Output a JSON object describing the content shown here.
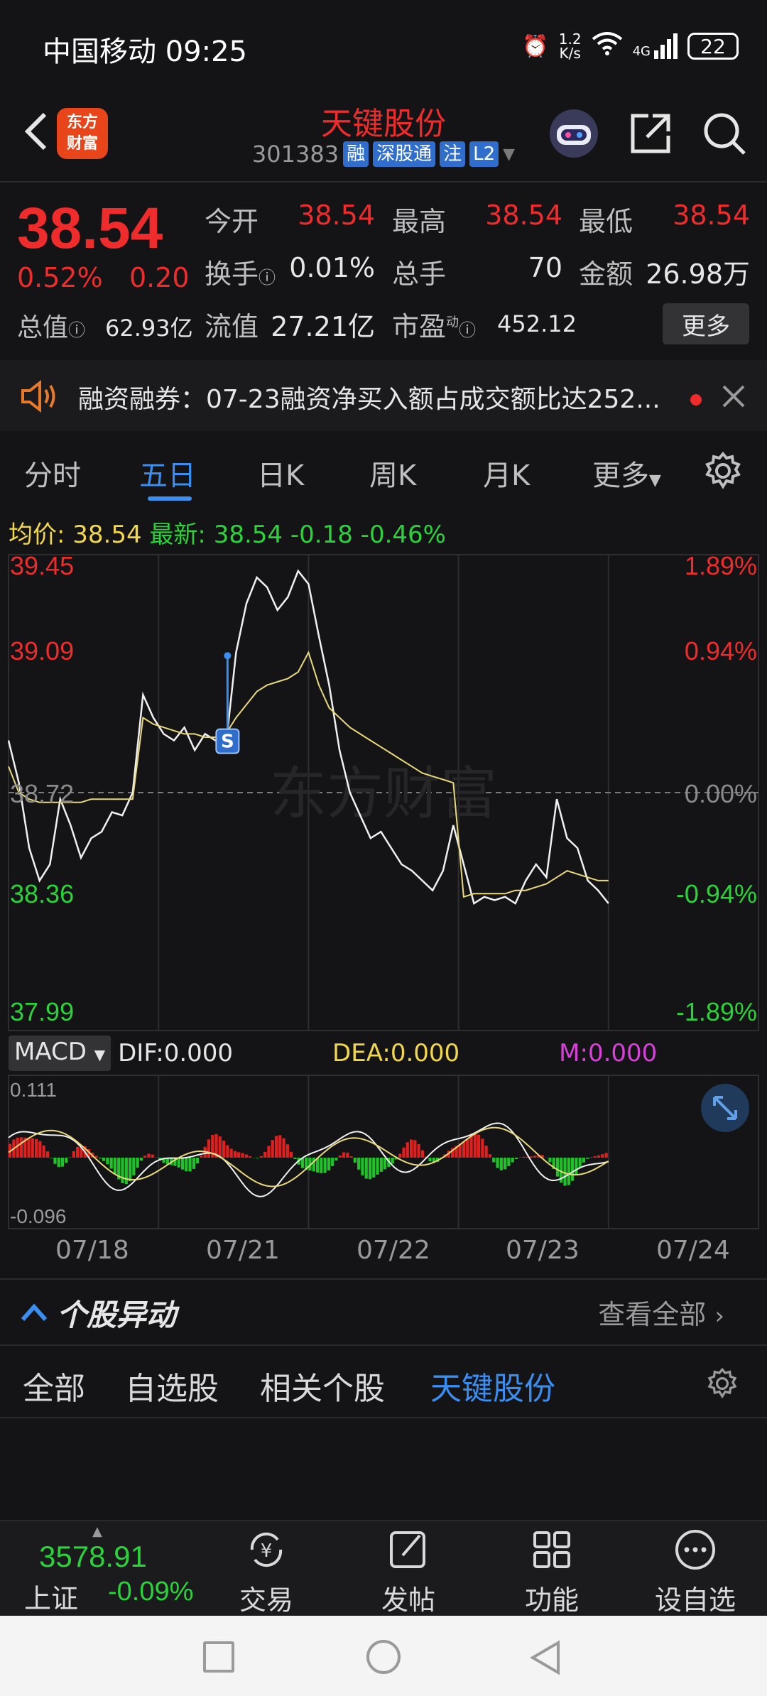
{
  "status_bar": {
    "carrier": "中国移动",
    "time": "09:25",
    "net_speed_top": "1.2",
    "net_speed_bottom": "K/s",
    "signal": "4G",
    "battery": "22"
  },
  "header": {
    "logo_line1": "东方",
    "logo_line2": "财富",
    "stock_name": "天键股份",
    "stock_code": "301383",
    "tags": [
      "融",
      "深股通",
      "注",
      "L2"
    ]
  },
  "quote": {
    "price": "38.54",
    "change_pct": "0.52%",
    "change_amt": "0.20",
    "open_label": "今开",
    "open": "38.54",
    "high_label": "最高",
    "high": "38.54",
    "low_label": "最低",
    "low": "38.54",
    "turnover_label": "换手",
    "turnover": "0.01%",
    "volume_label": "总手",
    "volume": "70",
    "amount_label": "金额",
    "amount": "26.98万",
    "mktcap_label": "总值",
    "mktcap": "62.93亿",
    "float_label": "流值",
    "float_cap": "27.21亿",
    "pe_label": "市盈",
    "pe_sup": "动",
    "pe": "452.12",
    "more_label": "更多"
  },
  "news": {
    "text": "融资融券：07-23融资净买入额占成交额比达252..."
  },
  "tabs": [
    "分时",
    "五日",
    "日K",
    "周K",
    "月K",
    "更多"
  ],
  "chart_info": {
    "avg_label": "均价:",
    "avg": "38.54",
    "latest_label": "最新:",
    "latest": "38.54",
    "chg": "-0.18",
    "chg_pct": "-0.46%"
  },
  "watermark": "东方财富",
  "marker": "S",
  "macd": {
    "selector": "MACD",
    "dif": "DIF:0.000",
    "dea": "DEA:0.000",
    "m": "M:0.000",
    "top": "0.111",
    "bottom": "-0.096"
  },
  "chart_data": {
    "type": "line",
    "x": [
      "07/18",
      "07/21",
      "07/22",
      "07/23",
      "07/24"
    ],
    "y_ticks_left": [
      "39.45",
      "39.09",
      "38.72",
      "38.36",
      "37.99"
    ],
    "y_ticks_right": [
      "1.89%",
      "0.94%",
      "0.00%",
      "-0.94%",
      "-1.89%"
    ],
    "ylim": [
      37.99,
      39.45
    ],
    "prev_close": 38.72,
    "series": [
      {
        "values": [
          38.88,
          38.75,
          38.55,
          38.45,
          38.5,
          38.7,
          38.62,
          38.52,
          38.58,
          38.6,
          38.66,
          38.65,
          38.72,
          39.02,
          38.95,
          38.9,
          38.88,
          38.92,
          38.85,
          38.9,
          38.88,
          38.86,
          39.15,
          39.3,
          39.38,
          39.35,
          39.28,
          39.32,
          39.4,
          39.36,
          39.2,
          39.05,
          38.85,
          38.72,
          38.65,
          38.58,
          38.6,
          38.55,
          38.5,
          38.48,
          38.45,
          38.42,
          38.48,
          38.62,
          38.5,
          38.38,
          38.4,
          38.39,
          38.4,
          38.38,
          38.45,
          38.5,
          38.46,
          38.7,
          38.58,
          38.55,
          38.45,
          38.42,
          38.38
        ]
      },
      {
        "values": [
          38.8,
          38.72,
          38.7,
          38.69,
          38.69,
          38.69,
          38.69,
          38.69,
          38.7,
          38.7,
          38.7,
          38.7,
          38.7,
          38.95,
          38.93,
          38.92,
          38.91,
          38.9,
          38.9,
          38.89,
          38.89,
          38.9,
          38.95,
          38.99,
          39.03,
          39.05,
          39.06,
          39.07,
          39.09,
          39.15,
          39.05,
          38.98,
          38.95,
          38.92,
          38.9,
          38.88,
          38.86,
          38.84,
          38.82,
          38.8,
          38.78,
          38.77,
          38.76,
          38.75,
          38.4,
          38.41,
          38.41,
          38.41,
          38.41,
          38.42,
          38.42,
          38.43,
          38.44,
          38.46,
          38.48,
          38.47,
          38.46,
          38.45,
          38.45
        ]
      }
    ]
  },
  "dates": [
    "07/18",
    "07/21",
    "07/22",
    "07/23",
    "07/24"
  ],
  "section": {
    "title": "个股异动",
    "view_all": "查看全部"
  },
  "filters": [
    "全部",
    "自选股",
    "相关个股",
    "天键股份"
  ],
  "bottom": {
    "index_value": "3578.91",
    "index_name": "上证",
    "index_chg": "-0.09%",
    "nav": [
      "交易",
      "发帖",
      "功能",
      "设自选"
    ]
  }
}
